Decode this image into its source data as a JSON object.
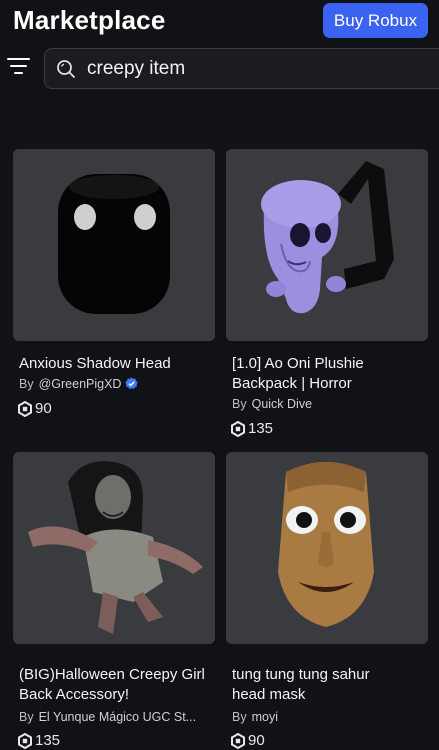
{
  "header": {
    "title": "Marketplace",
    "buy_button_label": "Buy Robux"
  },
  "search": {
    "query": "creepy item"
  },
  "colors": {
    "background": "#111216",
    "accent": "#3a63f2",
    "card_bg": "#393b3f",
    "verified": "#3a7bff"
  },
  "items": [
    {
      "name_line1": "Anxious Shadow Head",
      "name_line2": "",
      "by_label": "By",
      "creator": "@GreenPigXD",
      "verified": true,
      "price": "90"
    },
    {
      "name_line1": "[1.0] Ao Oni Plushie",
      "name_line2": "Backpack | Horror",
      "by_label": "By",
      "creator": "Quick Dive",
      "verified": false,
      "price": "135"
    },
    {
      "name_line1": "(BIG)Halloween Creepy Girl",
      "name_line2": "Back Accessory!",
      "by_label": "By",
      "creator": "El Yunque Mágico UGC St...",
      "verified": false,
      "price": "135"
    },
    {
      "name_line1": "tung tung tung sahur",
      "name_line2": "head mask",
      "by_label": "By",
      "creator": "moyi",
      "verified": false,
      "price": "90"
    }
  ]
}
